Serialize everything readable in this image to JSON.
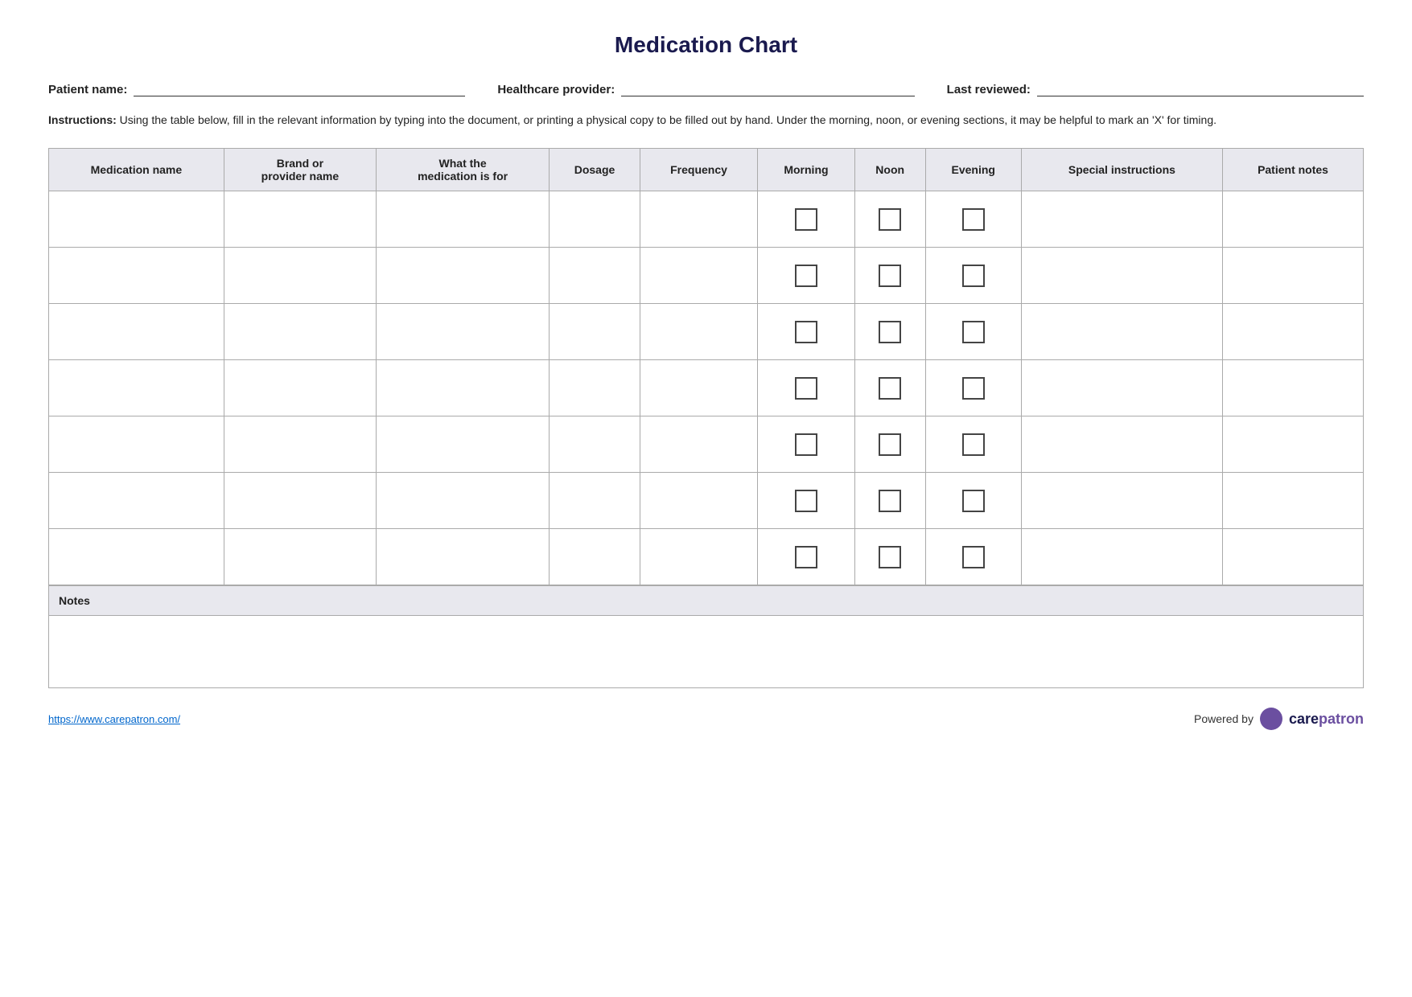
{
  "title": "Medication Chart",
  "patient_info": {
    "patient_name_label": "Patient name:",
    "healthcare_provider_label": "Healthcare provider:",
    "last_reviewed_label": "Last reviewed:"
  },
  "instructions": {
    "bold": "Instructions:",
    "text": " Using the table below, fill in the relevant information by typing into the document, or printing a physical copy to be filled out by hand. Under the morning, noon, or evening sections, it may be helpful to mark an 'X' for timing."
  },
  "table": {
    "headers": [
      "Medication name",
      "Brand or provider name",
      "What the medication is for",
      "Dosage",
      "Frequency",
      "Morning",
      "Noon",
      "Evening",
      "Special instructions",
      "Patient notes"
    ],
    "rows": 7,
    "notes_label": "Notes"
  },
  "footer": {
    "link": "https://www.carepatron.com/",
    "powered_by": "Powered by",
    "brand": "carepatron"
  }
}
